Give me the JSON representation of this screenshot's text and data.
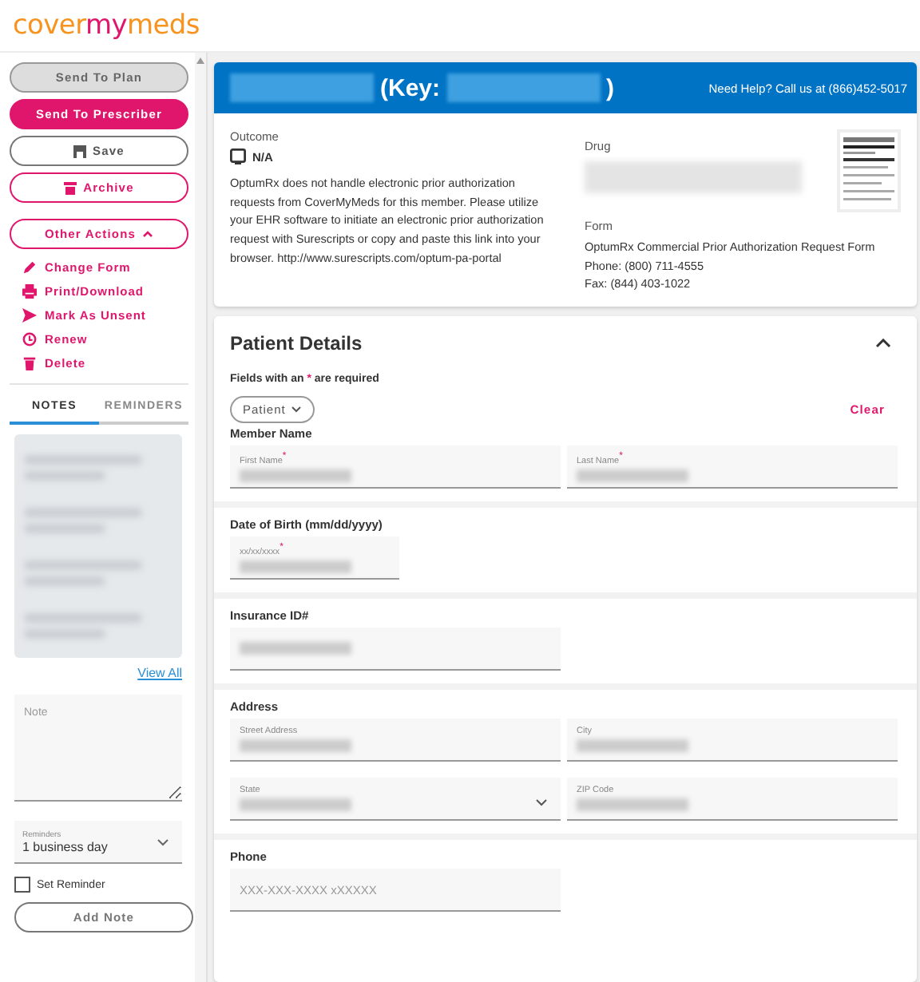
{
  "logo": {
    "parts": [
      "cover",
      "my",
      "meds"
    ]
  },
  "sidebar": {
    "buttons": [
      {
        "label": "Send To Plan",
        "kind": "gray"
      },
      {
        "label": "Send To Prescriber",
        "kind": "primary"
      },
      {
        "label": "Save",
        "kind": "outline"
      },
      {
        "label": "Archive",
        "kind": "pink"
      }
    ],
    "other_actions": {
      "label": "Other Actions",
      "expanded": true
    },
    "actions": [
      {
        "label": "Change Form"
      },
      {
        "label": "Print/Download"
      },
      {
        "label": "Mark As Unsent"
      },
      {
        "label": "Renew"
      },
      {
        "label": "Delete"
      }
    ],
    "tabs": [
      {
        "label": "NOTES",
        "selected": true
      },
      {
        "label": "REMINDERS",
        "selected": false
      }
    ],
    "view_all": "View All",
    "note_field": {
      "placeholder": "Note"
    },
    "reminders_select": {
      "label": "Reminders",
      "value": "1 business day"
    },
    "set_reminder": {
      "label": "Set Reminder",
      "checked": false
    },
    "add_note": "Add Note"
  },
  "header": {
    "key_label": "(Key:",
    "closing": ")",
    "help": "Need Help? Call us at (866)452-5017"
  },
  "summary": {
    "outcome_label": "Outcome",
    "outcome_value": "N/A",
    "message": "OptumRx does not handle electronic prior authorization requests from CoverMyMeds for this member. Please utilize your EHR software to initiate an electronic prior authorization request with Surescripts or copy and paste this link into your browser. http://www.surescripts.com/optum-pa-portal",
    "drug_label": "Drug",
    "form_label": "Form",
    "form_lines": [
      "OptumRx Commercial Prior Authorization Request Form",
      "Phone: (800) 711-4555",
      "Fax: (844) 403-1022"
    ]
  },
  "patient": {
    "title": "Patient Details",
    "expanded": true,
    "required_note": {
      "before": "Fields with an",
      "mark": "*",
      "after": "are required"
    },
    "filter": "Patient",
    "clear": "Clear",
    "sections": [
      {
        "title": "Member Name",
        "fields": [
          {
            "label": "First Name$^{*}$",
            "kind": "text"
          },
          {
            "label": "Last Name$^{*}$",
            "kind": "text"
          }
        ]
      },
      {
        "title": "Date of Birth (mm/dd/yyyy)",
        "fields": [
          {
            "label": "xx/xx/xxxx$^{*}$",
            "kind": "short"
          }
        ]
      },
      {
        "title": "Insurance ID#",
        "fields": [
          {
            "kind": "text"
          }
        ]
      },
      {
        "title": "Address",
        "fields": [
          {
            "label": "Street Address",
            "kind": "text"
          },
          {
            "label": "City",
            "kind": "text"
          },
          {
            "label": "State",
            "kind": "select"
          },
          {
            "label": "ZIP Code",
            "kind": "text"
          }
        ]
      },
      {
        "title": "Phone",
        "fields": [
          {
            "placeholder": "XXX-XXX-XXXX xXXXXX",
            "kind": "text"
          }
        ]
      }
    ]
  }
}
